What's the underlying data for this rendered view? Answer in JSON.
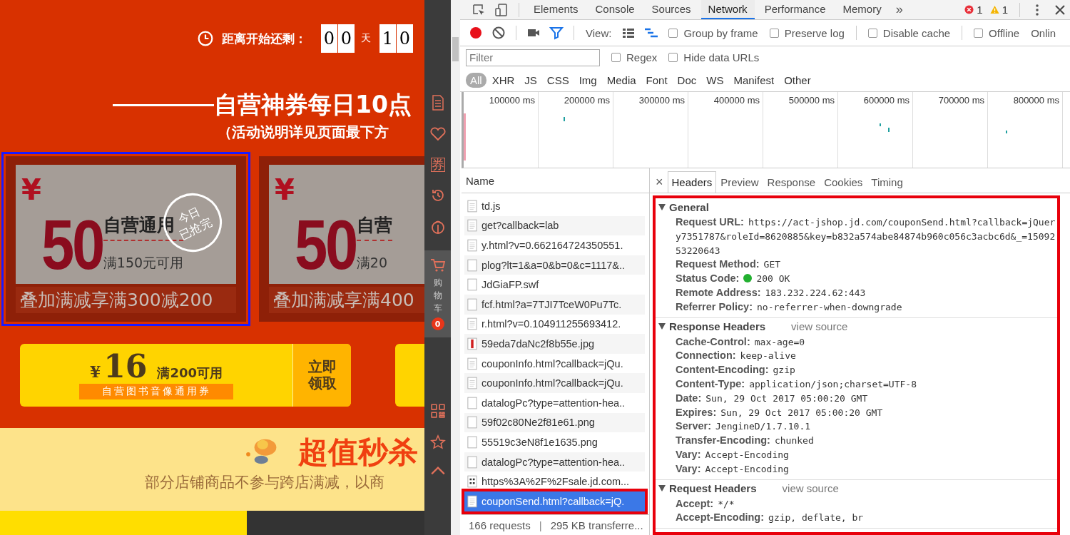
{
  "page": {
    "countdown": {
      "label": "距离开始还剩：",
      "days": [
        "0",
        "0"
      ],
      "days_unit": "天",
      "hours": [
        "1",
        "0"
      ]
    },
    "headline": "自营神券每日10点",
    "subline": "（活动说明详见页面最下方",
    "coupons": [
      {
        "currency": "¥",
        "amount": "50",
        "scope": "自营通用",
        "threshold": "满150元可用",
        "bonus": "叠加满减享满300减200",
        "stamp": [
          "今日",
          "已抢完"
        ],
        "highlighted": true
      },
      {
        "currency": "¥",
        "amount": "50",
        "scope": "自营",
        "threshold": "满20",
        "bonus": "叠加满减享满400",
        "highlighted": false
      }
    ],
    "book_coupon": {
      "currency": "¥",
      "amount": "16",
      "threshold": "满200可用",
      "scope": "自营图书音像通用券",
      "action": "立即领取"
    },
    "promo": {
      "title": "超值秒杀",
      "note": "部分店铺商品不参与跨店满减，以商"
    }
  },
  "sidebar": {
    "coupon_glyph": "券",
    "cart_label": "购物车",
    "cart_count": "0"
  },
  "devtools": {
    "tabs": [
      {
        "label": "Elements",
        "selected": false
      },
      {
        "label": "Console",
        "selected": false
      },
      {
        "label": "Sources",
        "selected": false
      },
      {
        "label": "Network",
        "selected": true
      },
      {
        "label": "Performance",
        "selected": false
      },
      {
        "label": "Memory",
        "selected": false
      }
    ],
    "more": "»",
    "errors": "1",
    "warnings": "1",
    "view_label": "View:",
    "toolbar_options": [
      {
        "label": "Group by frame",
        "checked": false
      },
      {
        "label": "Preserve log",
        "checked": false
      },
      {
        "label": "Disable cache",
        "checked": false
      },
      {
        "label": "Offline",
        "checked": false
      }
    ],
    "throttle": "Onlin",
    "filter": {
      "placeholder": "Filter"
    },
    "filter_options": [
      {
        "label": "Regex",
        "checked": false
      },
      {
        "label": "Hide data URLs",
        "checked": false
      }
    ],
    "types": [
      {
        "label": "All",
        "selected": true
      },
      {
        "label": "XHR",
        "selected": false
      },
      {
        "label": "JS",
        "selected": false
      },
      {
        "label": "CSS",
        "selected": false
      },
      {
        "label": "Img",
        "selected": false
      },
      {
        "label": "Media",
        "selected": false
      },
      {
        "label": "Font",
        "selected": false
      },
      {
        "label": "Doc",
        "selected": false
      },
      {
        "label": "WS",
        "selected": false
      },
      {
        "label": "Manifest",
        "selected": false
      },
      {
        "label": "Other",
        "selected": false
      }
    ],
    "timeline_ticks": [
      "100000 ms",
      "200000 ms",
      "300000 ms",
      "400000 ms",
      "500000 ms",
      "600000 ms",
      "700000 ms",
      "800000 ms"
    ],
    "name_header": "Name",
    "requests": [
      {
        "name": "td.js",
        "kind": "script",
        "selected": false
      },
      {
        "name": "get?callback=lab",
        "kind": "script",
        "selected": false
      },
      {
        "name": "y.html?v=0.662164724350551.",
        "kind": "script",
        "selected": false
      },
      {
        "name": "plog?lt=1&a=0&b=0&c=1117&..",
        "kind": "blank",
        "selected": false
      },
      {
        "name": "JdGiaFP.swf",
        "kind": "blank",
        "selected": false
      },
      {
        "name": "fcf.html?a=7TJI7TceW0Pu7Tc.",
        "kind": "blank",
        "selected": false
      },
      {
        "name": "r.html?v=0.104911255693412.",
        "kind": "script",
        "selected": false
      },
      {
        "name": "59eda7daNc2f8b55e.jpg",
        "kind": "image",
        "selected": false
      },
      {
        "name": "couponInfo.html?callback=jQu.",
        "kind": "script",
        "selected": false
      },
      {
        "name": "couponInfo.html?callback=jQu.",
        "kind": "script",
        "selected": false
      },
      {
        "name": "datalogPc?type=attention-hea..",
        "kind": "blank",
        "selected": false
      },
      {
        "name": "59f02c80Ne2f81e61.png",
        "kind": "blank",
        "selected": false
      },
      {
        "name": "55519c3eN8f1e1635.png",
        "kind": "blank",
        "selected": false
      },
      {
        "name": "datalogPc?type=attention-hea..",
        "kind": "blank",
        "selected": false
      },
      {
        "name": "https%3A%2F%2Fsale.jd.com...",
        "kind": "qr",
        "selected": false
      },
      {
        "name": "couponSend.html?callback=jQ.",
        "kind": "script",
        "selected": true,
        "annotated": true
      }
    ],
    "summary": [
      "166 requests",
      "|",
      "295 KB transferre..."
    ],
    "detail_close": "×",
    "detail_tabs": [
      {
        "label": "Headers",
        "selected": true
      },
      {
        "label": "Preview",
        "selected": false
      },
      {
        "label": "Response",
        "selected": false
      },
      {
        "label": "Cookies",
        "selected": false
      },
      {
        "label": "Timing",
        "selected": false
      }
    ],
    "headers_annotated": true,
    "sections": [
      {
        "title": "General",
        "expanded": true,
        "rows": [
          {
            "name": "Request URL:",
            "value": "https://act-jshop.jd.com/couponSend.html?callback=jQuery7351787&roleId=8620885&key=b832a574abe84874b960c056c3acbc6d&_=1509253220643",
            "kind": "text"
          },
          {
            "name": "Request Method:",
            "value": "GET",
            "kind": "text"
          },
          {
            "name": "Status Code:",
            "value": "200 OK",
            "kind": "status"
          },
          {
            "name": "Remote Address:",
            "value": "183.232.224.62:443",
            "kind": "text"
          },
          {
            "name": "Referrer Policy:",
            "value": "no-referrer-when-downgrade",
            "kind": "text"
          }
        ]
      },
      {
        "title": "Response Headers",
        "link": "view source",
        "expanded": true,
        "rows": [
          {
            "name": "Cache-Control:",
            "value": "max-age=0",
            "kind": "text"
          },
          {
            "name": "Connection:",
            "value": "keep-alive",
            "kind": "text"
          },
          {
            "name": "Content-Encoding:",
            "value": "gzip",
            "kind": "text"
          },
          {
            "name": "Content-Type:",
            "value": "application/json;charset=UTF-8",
            "kind": "text"
          },
          {
            "name": "Date:",
            "value": "Sun, 29 Oct 2017 05:00:20 GMT",
            "kind": "text"
          },
          {
            "name": "Expires:",
            "value": "Sun, 29 Oct 2017 05:00:20 GMT",
            "kind": "text"
          },
          {
            "name": "Server:",
            "value": "JengineD/1.7.10.1",
            "kind": "text"
          },
          {
            "name": "Transfer-Encoding:",
            "value": "chunked",
            "kind": "text"
          },
          {
            "name": "Vary:",
            "value": "Accept-Encoding",
            "kind": "text"
          },
          {
            "name": "Vary:",
            "value": "Accept-Encoding",
            "kind": "text"
          }
        ]
      },
      {
        "title": "Request Headers",
        "link": "view source",
        "expanded": true,
        "rows": [
          {
            "name": "Accept:",
            "value": "*/*",
            "kind": "text"
          },
          {
            "name": "Accept-Encoding:",
            "value": "gzip, deflate, br",
            "kind": "text"
          }
        ]
      }
    ]
  }
}
